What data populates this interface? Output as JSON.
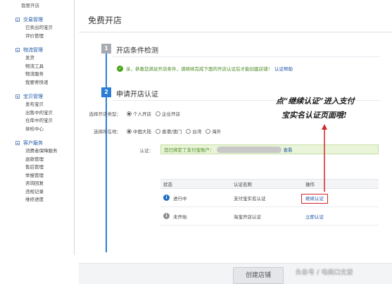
{
  "sidebar": {
    "top_item": "我要开店",
    "groups": [
      {
        "title": "交易管理",
        "items": [
          "已卖出的宝贝",
          "评价管理"
        ]
      },
      {
        "title": "物流管理",
        "items": [
          "发货",
          "物流工具",
          "物流服务",
          "我要寄快递"
        ]
      },
      {
        "title": "宝贝管理",
        "items": [
          "发布宝贝",
          "出售中的宝贝",
          "仓库中的宝贝",
          "体检中心"
        ]
      },
      {
        "title": "客户服务",
        "items": [
          "消费者保障服务",
          "退款管理",
          "售后管理",
          "举报管理",
          "咨询回复",
          "违规记录",
          "维修进度"
        ]
      }
    ]
  },
  "page": {
    "title": "免费开店"
  },
  "step1": {
    "number": "1",
    "title": "开店条件检测",
    "ok_icon": "check-circle-icon",
    "message": "亲，恭喜您满足开店条件，请继续完成下面的开店认证后才能创建店铺！",
    "link": "认证帮助"
  },
  "step2": {
    "number": "2",
    "title": "申请开店认证",
    "shop_type": {
      "label": "选择开店类型：",
      "options": [
        "个人开店",
        "企业开店"
      ],
      "selected": 0
    },
    "location": {
      "label": "选择所在地：",
      "options": [
        "中国大陆",
        "香港/澳门",
        "台湾",
        "海外"
      ],
      "selected": 0
    },
    "auth": {
      "label": "认证：",
      "text": "您已绑定了支付宝账户：",
      "link": "查看"
    }
  },
  "table": {
    "headers": [
      "状态",
      "认证名称",
      "操作"
    ],
    "rows": [
      {
        "icon": "info-icon",
        "status": "进行中",
        "name": "支付宝实名认证",
        "action": "继续认证",
        "highlight": true
      },
      {
        "icon": "info-icon",
        "status": "未开始",
        "name": "淘宝开店认证",
        "action": "立即认证",
        "highlight": false
      }
    ]
  },
  "annotation": {
    "line1": "点“继续认证”进入支付",
    "line2": "宝实名认证页面哦!",
    "color": "#d3262b"
  },
  "footer": {
    "create_button": "创建店铺",
    "watermark": "头条号 / 电商口文波"
  },
  "colors": {
    "accent": "#2a7ed6",
    "link": "#1f56a6",
    "success": "#4aa41b",
    "highlight": "#d3262b"
  }
}
